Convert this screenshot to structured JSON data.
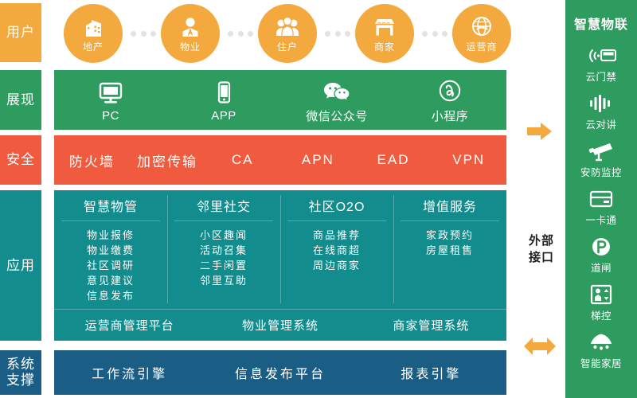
{
  "sidebar_left": {
    "items": [
      {
        "label": "用户",
        "name": "layer-label-user",
        "color": "#F4A93F"
      },
      {
        "label": "展现",
        "name": "layer-label-presentation",
        "color": "#2E9B5F"
      },
      {
        "label": "安全",
        "name": "layer-label-security",
        "color": "#F05B40"
      },
      {
        "label": "应用",
        "name": "layer-label-application",
        "color": "#128C8C"
      },
      {
        "label": "系统\n支撑",
        "label_line1": "系统",
        "label_line2": "支撑",
        "name": "layer-label-system-support",
        "color": "#1B5E85"
      }
    ]
  },
  "user_layer": {
    "nodes": [
      {
        "label": "地产",
        "icon": "building-icon"
      },
      {
        "label": "物业",
        "icon": "person-icon"
      },
      {
        "label": "住户",
        "icon": "people-group-icon"
      },
      {
        "label": "商家",
        "icon": "shop-icon"
      },
      {
        "label": "运营商",
        "icon": "globe-refresh-icon"
      }
    ]
  },
  "presentation_layer": {
    "items": [
      {
        "label": "PC",
        "icon": "monitor-icon"
      },
      {
        "label": "APP",
        "icon": "smartphone-icon"
      },
      {
        "label": "微信公众号",
        "icon": "wechat-icon"
      },
      {
        "label": "小程序",
        "icon": "mini-program-icon"
      }
    ]
  },
  "security_layer": {
    "items": [
      "防火墙",
      "加密传输",
      "CA",
      "APN",
      "EAD",
      "VPN"
    ]
  },
  "application_layer": {
    "columns": [
      {
        "title": "智慧物管",
        "items": [
          "物业报修",
          "物业缴费",
          "社区调研",
          "意见建议",
          "信息发布"
        ]
      },
      {
        "title": "邻里社交",
        "items": [
          "小区趣闻",
          "活动召集",
          "二手闲置",
          "邻里互助"
        ]
      },
      {
        "title": "社区O2O",
        "items": [
          "商品推荐",
          "在线商超",
          "周边商家"
        ]
      },
      {
        "title": "增值服务",
        "items": [
          "家政预约",
          "房屋租售"
        ]
      }
    ],
    "platforms": [
      "运营商管理平台",
      "物业管理系统",
      "商家管理系统"
    ]
  },
  "system_support_layer": {
    "items": [
      "工作流引擎",
      "信息发布平台",
      "报表引擎"
    ]
  },
  "connectors": {
    "external_interface_line1": "外部",
    "external_interface_line2": "接口",
    "arrow_right": "arrow-right-icon",
    "arrow_bidirectional": "arrow-bidirectional-icon"
  },
  "iot_panel": {
    "title": "智慧物联",
    "items": [
      {
        "label": "云门禁",
        "icon": "access-card-wireless-icon"
      },
      {
        "label": "云对讲",
        "icon": "audio-waveform-icon"
      },
      {
        "label": "安防监控",
        "icon": "cctv-camera-icon"
      },
      {
        "label": "一卡通",
        "icon": "smart-card-icon"
      },
      {
        "label": "道闸",
        "icon": "parking-barrier-icon"
      },
      {
        "label": "梯控",
        "icon": "elevator-control-icon"
      },
      {
        "label": "智能家居",
        "icon": "smart-lamp-icon"
      }
    ]
  },
  "colors": {
    "orange": "#F4A93F",
    "green": "#2E9B5F",
    "red": "#F05B40",
    "teal": "#128C8C",
    "blue": "#1B5E85",
    "white": "#FFFFFF"
  }
}
